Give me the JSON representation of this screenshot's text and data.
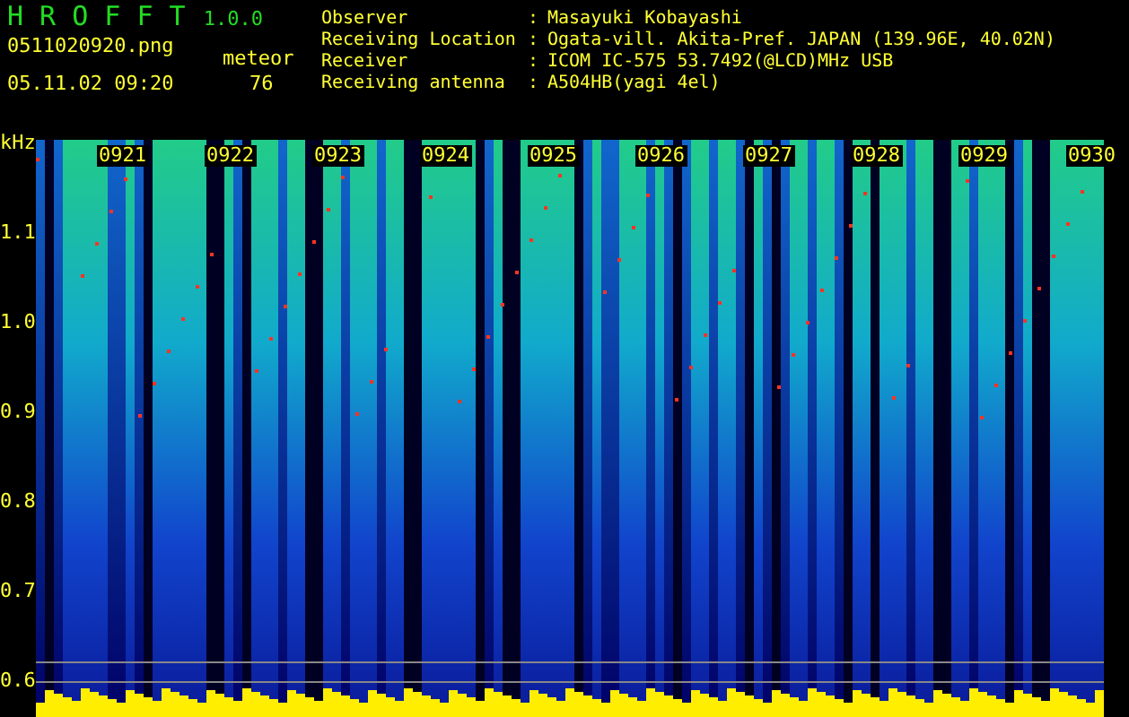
{
  "app": {
    "title": "H R O F F T",
    "version": "1.0.0"
  },
  "file": "0511020920.png",
  "datetime": "05.11.02 09:20",
  "meteor": {
    "label": "meteor",
    "count": "76"
  },
  "info": [
    {
      "label": "Observer",
      "separator": ":",
      "value": "Masayuki Kobayashi"
    },
    {
      "label": "Receiving Location",
      "separator": ":",
      "value": "Ogata-vill. Akita-Pref. JAPAN (139.96E, 40.02N)"
    },
    {
      "label": "Receiver",
      "separator": ":",
      "value": "ICOM IC-575 53.7492(@LCD)MHz USB"
    },
    {
      "label": "Receiving antenna",
      "separator": ":",
      "value": "A504HB(yagi 4el)"
    }
  ],
  "axis": {
    "unit": "kHz",
    "y_labels": [
      "1.1",
      "1.0",
      "0.9",
      "0.8",
      "0.7",
      "0.6"
    ],
    "time_labels": [
      "0921",
      "0922",
      "0923",
      "0924",
      "0925",
      "0926",
      "0927",
      "0928",
      "0929",
      "0930"
    ]
  }
}
